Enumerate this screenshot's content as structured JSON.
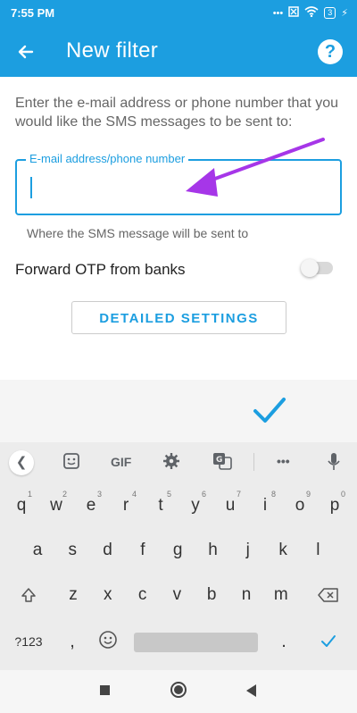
{
  "status": {
    "time": "7:55 PM",
    "battery": "3"
  },
  "header": {
    "title": "New filter",
    "help_glyph": "?"
  },
  "form": {
    "instruction": "Enter the e-mail address or phone number that you would like the SMS messages to be sent to:",
    "email_label": "E-mail address/phone number",
    "email_value": "",
    "helper": "Where the SMS message will be sent to",
    "otp_label": "Forward OTP from banks",
    "otp_enabled": false,
    "detail_button": "DETAILED SETTINGS"
  },
  "keyboard": {
    "toolbar": {
      "gif": "GIF",
      "more": "•••"
    },
    "row1": [
      {
        "k": "q",
        "h": "1"
      },
      {
        "k": "w",
        "h": "2"
      },
      {
        "k": "e",
        "h": "3"
      },
      {
        "k": "r",
        "h": "4"
      },
      {
        "k": "t",
        "h": "5"
      },
      {
        "k": "y",
        "h": "6"
      },
      {
        "k": "u",
        "h": "7"
      },
      {
        "k": "i",
        "h": "8"
      },
      {
        "k": "o",
        "h": "9"
      },
      {
        "k": "p",
        "h": "0"
      }
    ],
    "row2": [
      "a",
      "s",
      "d",
      "f",
      "g",
      "h",
      "j",
      "k",
      "l"
    ],
    "row3": [
      "z",
      "x",
      "c",
      "v",
      "b",
      "n",
      "m"
    ],
    "row4": {
      "symbols": "?123",
      "comma": ",",
      "period": "."
    }
  },
  "colors": {
    "accent": "#1c9ee0",
    "annotation_arrow": "#a636e8"
  },
  "icons": [
    "back-arrow-icon",
    "help-icon",
    "checkmark-icon",
    "sticker-icon",
    "settings-icon",
    "translate-icon",
    "mic-icon",
    "emoji-icon",
    "shift-icon",
    "backspace-icon",
    "enter-icon",
    "wifi-icon"
  ]
}
